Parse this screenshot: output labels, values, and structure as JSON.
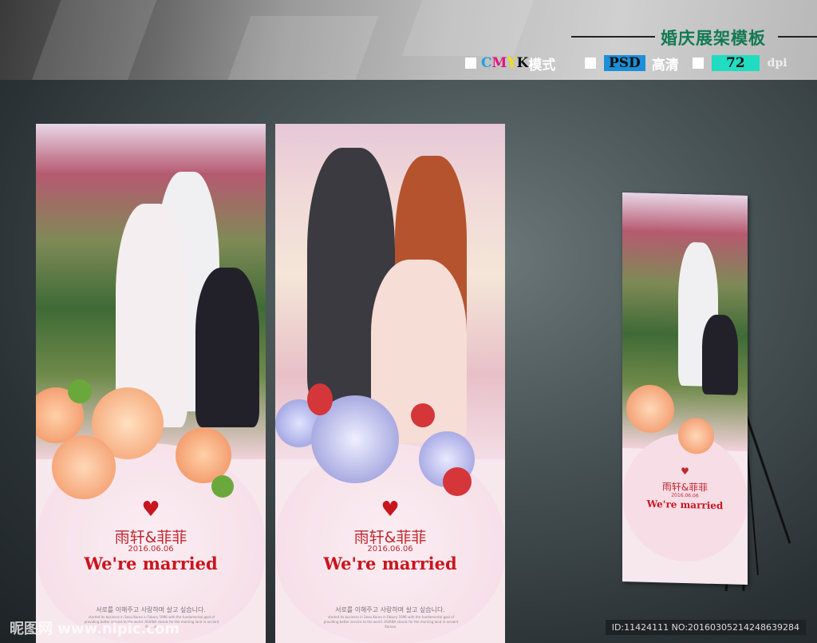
{
  "header": {
    "title": "婚庆展架模板",
    "color_mode_prefix": "CMYK",
    "cmyk_letters": [
      "C",
      "M",
      "Y",
      "K"
    ],
    "color_mode_label": "模式",
    "format_badge": "PSD",
    "format_label": "高清",
    "resolution_badge": "72",
    "resolution_unit": "dpi"
  },
  "posters": [
    {
      "names": "雨轩&菲菲",
      "date": "2016.06.06",
      "headline": "We're married",
      "korean": "서로를 이해주고 사랑하며 살고 싶습니다.",
      "body": "started its business in Seou Korea in Fabury 1996 with the fundamental goal of providing better service to the world. ASIANA stands for the morning land in ancient Korean."
    },
    {
      "names": "雨轩&菲菲",
      "date": "2016.06.06",
      "headline": "We're married",
      "korean": "서로를 이해주고 사랑하며 살고 싶습니다.",
      "body": "started its business in Seou Korea in Fabury 1996 with the fundamental goal of providing better service to the world. ASIANA stands for the morning land in ancient Korean."
    }
  ],
  "stand_poster": {
    "names": "雨轩&菲菲",
    "date": "2016.06.06",
    "headline": "We're married"
  },
  "footer": {
    "watermark": "昵图网 www.nipic.com",
    "id_text": "ID:11424111 NO:20160305214248639284"
  },
  "colors": {
    "title": "#127a52",
    "headline": "#c8161e",
    "psd": "#1c8fd8",
    "dpi": "#20dcc0"
  }
}
